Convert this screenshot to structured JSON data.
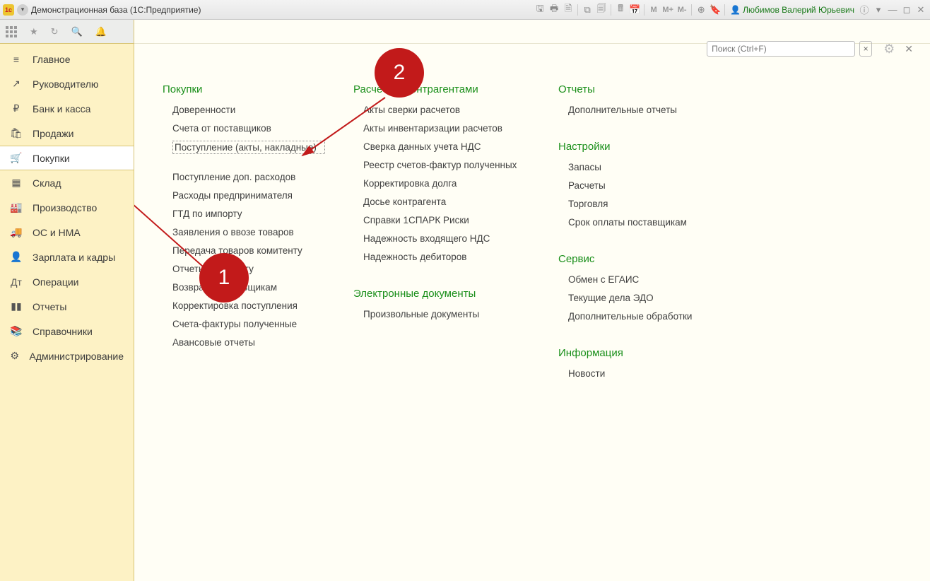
{
  "title_bar": {
    "app_title": "Демонстрационная база  (1С:Предприятие)",
    "user_name": "Любимов Валерий Юрьевич",
    "m_labels": [
      "M",
      "M+",
      "M-"
    ]
  },
  "search": {
    "placeholder": "Поиск (Ctrl+F)"
  },
  "sidebar": {
    "items": [
      {
        "icon": "≡",
        "label": "Главное",
        "key": "main"
      },
      {
        "icon": "↗",
        "label": "Руководителю",
        "key": "manager"
      },
      {
        "icon": "₽",
        "label": "Банк и касса",
        "key": "bank"
      },
      {
        "icon": "🛍",
        "label": "Продажи",
        "key": "sales"
      },
      {
        "icon": "🛒",
        "label": "Покупки",
        "key": "purchases",
        "active": true
      },
      {
        "icon": "▦",
        "label": "Склад",
        "key": "warehouse"
      },
      {
        "icon": "🏭",
        "label": "Производство",
        "key": "production"
      },
      {
        "icon": "🚚",
        "label": "ОС и НМА",
        "key": "os-nma"
      },
      {
        "icon": "👤",
        "label": "Зарплата и кадры",
        "key": "salary"
      },
      {
        "icon": "Дт",
        "label": "Операции",
        "key": "operations"
      },
      {
        "icon": "▮▮",
        "label": "Отчеты",
        "key": "reports-nav"
      },
      {
        "icon": "📚",
        "label": "Справочники",
        "key": "catalogs"
      },
      {
        "icon": "⚙",
        "label": "Администрирование",
        "key": "admin"
      }
    ]
  },
  "sections": {
    "col1": [
      {
        "title": "Покупки",
        "links": [
          {
            "t": "Доверенности",
            "k": "proxy"
          },
          {
            "t": "Счета от поставщиков",
            "k": "vendor-invoices"
          },
          {
            "t": "Поступление (акты, накладные)",
            "k": "receipt",
            "dotted": true
          },
          {
            "t": "Поступление доп. расходов",
            "k": "extra-cost"
          },
          {
            "t": "Расходы предпринимателя",
            "k": "entrepreneur-exp"
          },
          {
            "t": "ГТД по импорту",
            "k": "gtd-import"
          },
          {
            "t": "Заявления о ввозе товаров",
            "k": "import-apps"
          },
          {
            "t": "Передача товаров комитенту",
            "k": "transfer-goods"
          },
          {
            "t": "Отчеты комитенту",
            "k": "commitent-reports"
          },
          {
            "t": "Возвраты поставщикам",
            "k": "returns"
          },
          {
            "t": "Корректировка поступления",
            "k": "receipt-adjust"
          },
          {
            "t": "Счета-фактуры полученные",
            "k": "invoices-received"
          },
          {
            "t": "Авансовые отчеты",
            "k": "advance-reports"
          }
        ]
      }
    ],
    "col2": [
      {
        "title": "Расчеты с контрагентами",
        "links": [
          {
            "t": "Акты сверки расчетов",
            "k": "reconcile-acts"
          },
          {
            "t": "Акты инвентаризации расчетов",
            "k": "inventory-acts"
          },
          {
            "t": "Сверка данных учета НДС",
            "k": "vat-reconcile"
          },
          {
            "t": "Реестр счетов-фактур полученных",
            "k": "invoice-registry"
          },
          {
            "t": "Корректировка долга",
            "k": "debt-adjust"
          },
          {
            "t": "Досье контрагента",
            "k": "dossier"
          },
          {
            "t": "Справки 1СПАРК Риски",
            "k": "spark-risks"
          },
          {
            "t": "Надежность входящего НДС",
            "k": "vat-in-reliability"
          },
          {
            "t": "Надежность дебиторов",
            "k": "debtor-reliability"
          }
        ]
      },
      {
        "title": "Электронные документы",
        "links": [
          {
            "t": "Произвольные документы",
            "k": "arbitrary-docs"
          }
        ]
      }
    ],
    "col3": [
      {
        "title": "Отчеты",
        "links": [
          {
            "t": "Дополнительные отчеты",
            "k": "extra-reports"
          }
        ]
      },
      {
        "title": "Настройки",
        "links": [
          {
            "t": "Запасы",
            "k": "stocks"
          },
          {
            "t": "Расчеты",
            "k": "settlements"
          },
          {
            "t": "Торговля",
            "k": "trade"
          },
          {
            "t": "Срок оплаты поставщикам",
            "k": "payment-term"
          }
        ]
      },
      {
        "title": "Сервис",
        "links": [
          {
            "t": "Обмен с ЕГАИС",
            "k": "egais"
          },
          {
            "t": "Текущие дела ЭДО",
            "k": "edo"
          },
          {
            "t": "Дополнительные обработки",
            "k": "extra-proc"
          }
        ]
      },
      {
        "title": "Информация",
        "links": [
          {
            "t": "Новости",
            "k": "news"
          }
        ]
      }
    ]
  },
  "annotations": {
    "bubble1": "1",
    "bubble2": "2"
  }
}
